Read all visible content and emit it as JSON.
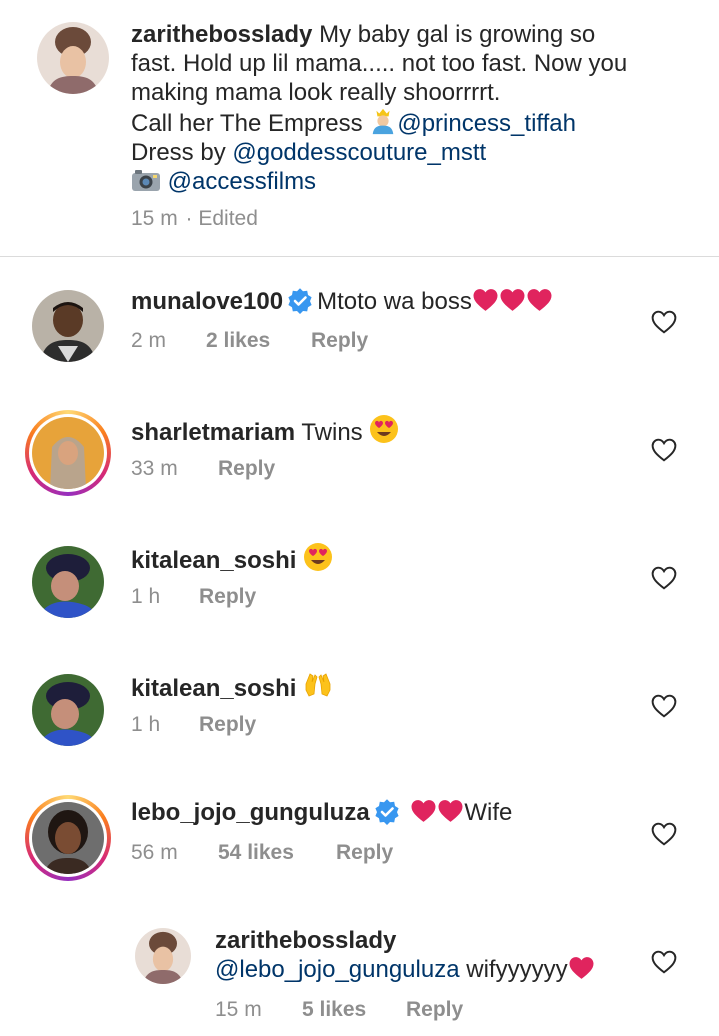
{
  "caption": {
    "username": "zarithebosslady",
    "line1": "My baby gal is growing so",
    "line2": "fast. Hold up lil mama..... not too fast. Now you",
    "line3": "making mama look really shoorrrrt.",
    "line4_text": "Call her The Empress",
    "line4_mention": "@princess_tiffah",
    "line5_text": "Dress by",
    "line5_mention": "@goddesscouture_mstt",
    "line6_mention": "@accessfilms",
    "time": "15 m",
    "edited": "· Edited"
  },
  "comments": [
    {
      "username": "munalove100",
      "text": "Mtoto wa boss",
      "time": "2 m",
      "likes": "2 likes",
      "reply": "Reply"
    },
    {
      "username": "sharletmariam",
      "text": "Twins",
      "time": "33 m",
      "reply": "Reply"
    },
    {
      "username": "kitalean_soshi",
      "time": "1 h",
      "reply": "Reply"
    },
    {
      "username": "kitalean_soshi",
      "time": "1 h",
      "reply": "Reply"
    },
    {
      "username": "lebo_jojo_gunguluza",
      "text": "Wife",
      "time": "56 m",
      "likes": "54 likes",
      "reply": "Reply"
    }
  ],
  "reply": {
    "username": "zarithebosslady",
    "mention": "@lebo_jojo_gunguluza",
    "text": "wifyyyyyy",
    "time": "15 m",
    "likes": "5 likes",
    "reply": "Reply"
  },
  "icons": {
    "heart_outline": "heart-outline-icon",
    "verified": "verified-badge-icon",
    "heart_red": "red-heart-emoji",
    "heart_eyes": "heart-eyes-emoji",
    "raised_hands": "raised-hands-emoji",
    "camera": "camera-emoji",
    "prince": "person-with-crown-emoji"
  },
  "colors": {
    "text": "#262626",
    "meta": "#8e8e8e",
    "mention": "#003569",
    "verified": "#3897f0",
    "heart": "#e0245e"
  }
}
